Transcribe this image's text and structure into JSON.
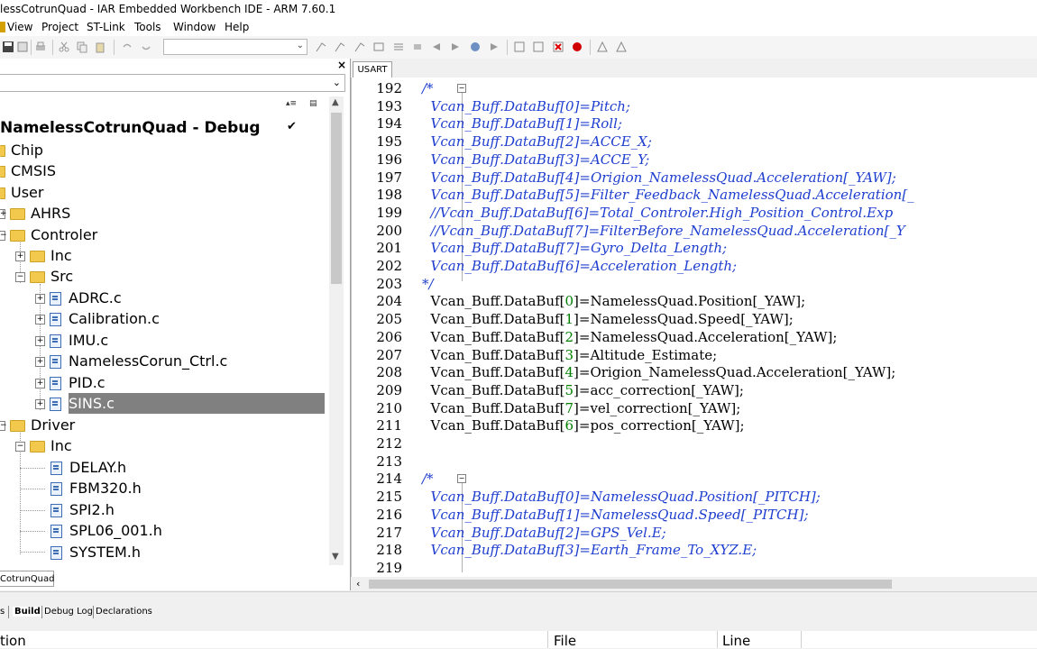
{
  "window": {
    "title": "lessCotrunQuad - IAR Embedded Workbench IDE - ARM 7.60.1"
  },
  "menu": [
    "View",
    "Project",
    "ST-Link",
    "Tools",
    "Window",
    "Help"
  ],
  "workspace": {
    "project_title": "NamelessCotrunQuad - Debug",
    "tab_label": "CotrunQuad",
    "tree": [
      {
        "label": "Chip",
        "icon": "folder-icon"
      },
      {
        "label": "CMSIS",
        "icon": "folder-icon"
      },
      {
        "label": "User",
        "icon": "folder-icon"
      },
      {
        "label": "AHRS",
        "icon": "folder-icon"
      },
      {
        "label": "Controler",
        "icon": "folder-icon"
      },
      {
        "label": "Inc",
        "icon": "folder-icon"
      },
      {
        "label": "Src",
        "icon": "folder-icon"
      },
      {
        "label": "ADRC.c",
        "icon": "file-icon"
      },
      {
        "label": "Calibration.c",
        "icon": "file-icon"
      },
      {
        "label": "IMU.c",
        "icon": "file-icon"
      },
      {
        "label": "NamelessCorun_Ctrl.c",
        "icon": "file-icon"
      },
      {
        "label": "PID.c",
        "icon": "file-icon"
      },
      {
        "label": "SINS.c",
        "icon": "file-icon"
      },
      {
        "label": "Driver",
        "icon": "folder-icon"
      },
      {
        "label": "Inc",
        "icon": "folder-icon"
      },
      {
        "label": "DELAY.h",
        "icon": "file-icon"
      },
      {
        "label": "FBM320.h",
        "icon": "file-icon"
      },
      {
        "label": "SPI2.h",
        "icon": "file-icon"
      },
      {
        "label": "SPL06_001.h",
        "icon": "file-icon"
      },
      {
        "label": "SYSTEM.h",
        "icon": "file-icon"
      }
    ]
  },
  "editor": {
    "tab_label": "USART",
    "lines": [
      {
        "n": "192",
        "t": "/*"
      },
      {
        "n": "193",
        "t": "  Vcan_Buff.DataBuf[0]=Pitch;"
      },
      {
        "n": "194",
        "t": "  Vcan_Buff.DataBuf[1]=Roll;"
      },
      {
        "n": "195",
        "t": "  Vcan_Buff.DataBuf[2]=ACCE_X;"
      },
      {
        "n": "196",
        "t": "  Vcan_Buff.DataBuf[3]=ACCE_Y;"
      },
      {
        "n": "197",
        "t": "  Vcan_Buff.DataBuf[4]=Origion_NamelessQuad.Acceleration[_YAW];"
      },
      {
        "n": "198",
        "t": "  Vcan_Buff.DataBuf[5]=Filter_Feedback_NamelessQuad.Acceleration[_"
      },
      {
        "n": "199",
        "t": "  //Vcan_Buff.DataBuf[6]=Total_Controler.High_Position_Control.Exp"
      },
      {
        "n": "200",
        "t": "  //Vcan_Buff.DataBuf[7]=FilterBefore_NamelessQuad.Acceleration[_Y"
      },
      {
        "n": "201",
        "t": "  Vcan_Buff.DataBuf[7]=Gyro_Delta_Length;"
      },
      {
        "n": "202",
        "t": "  Vcan_Buff.DataBuf[6]=Acceleration_Length;"
      },
      {
        "n": "203",
        "t": "*/"
      },
      {
        "n": "204",
        "t": "  Vcan_Buff.DataBuf[0]=NamelessQuad.Position[_YAW];"
      },
      {
        "n": "205",
        "t": "  Vcan_Buff.DataBuf[1]=NamelessQuad.Speed[_YAW];"
      },
      {
        "n": "206",
        "t": "  Vcan_Buff.DataBuf[2]=NamelessQuad.Acceleration[_YAW];"
      },
      {
        "n": "207",
        "t": "  Vcan_Buff.DataBuf[3]=Altitude_Estimate;"
      },
      {
        "n": "208",
        "t": "  Vcan_Buff.DataBuf[4]=Origion_NamelessQuad.Acceleration[_YAW];"
      },
      {
        "n": "209",
        "t": "  Vcan_Buff.DataBuf[5]=acc_correction[_YAW];"
      },
      {
        "n": "210",
        "t": "  Vcan_Buff.DataBuf[7]=vel_correction[_YAW];"
      },
      {
        "n": "211",
        "t": "  Vcan_Buff.DataBuf[6]=pos_correction[_YAW];"
      },
      {
        "n": "212",
        "t": ""
      },
      {
        "n": "213",
        "t": ""
      },
      {
        "n": "214",
        "t": "/*"
      },
      {
        "n": "215",
        "t": "  Vcan_Buff.DataBuf[0]=NamelessQuad.Position[_PITCH];"
      },
      {
        "n": "216",
        "t": "  Vcan_Buff.DataBuf[1]=NamelessQuad.Speed[_PITCH];"
      },
      {
        "n": "217",
        "t": "  Vcan_Buff.DataBuf[2]=GPS_Vel.E;"
      },
      {
        "n": "218",
        "t": "  Vcan_Buff.DataBuf[3]=Earth_Frame_To_XYZ.E;"
      },
      {
        "n": "219",
        "t": ""
      }
    ]
  },
  "bottom_tabs": [
    "s",
    "Build",
    "Debug Log",
    "Declarations"
  ],
  "messages": {
    "col_message": "tion",
    "col_file": "File",
    "col_line": "Line"
  },
  "colors": {
    "comment": "#1e3ecf",
    "number": "#008000",
    "selection": "#808080"
  }
}
